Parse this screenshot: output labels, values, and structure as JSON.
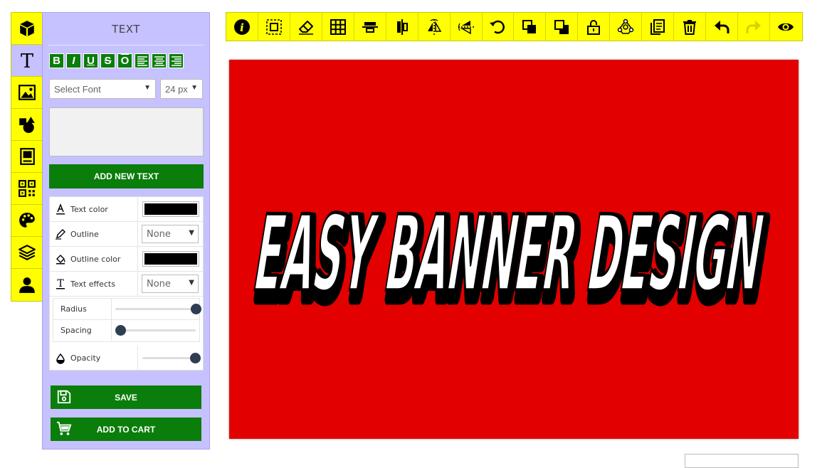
{
  "panel": {
    "title": "TEXT",
    "format_buttons": [
      "B",
      "I",
      "U",
      "S",
      "O"
    ],
    "font_select": "Select Font",
    "size_select": "24 px",
    "add_text_label": "ADD NEW TEXT",
    "properties": {
      "text_color_label": "Text color",
      "text_color_value": "#000000",
      "outline_label": "Outline",
      "outline_value": "None",
      "outline_color_label": "Outline color",
      "outline_color_value": "#000000",
      "text_effects_label": "Text effects",
      "text_effects_value": "None",
      "radius_label": "Radius",
      "radius_value": 1.0,
      "spacing_label": "Spacing",
      "spacing_value": 0.0,
      "opacity_label": "Opacity",
      "opacity_value": 1.0
    },
    "save_label": "SAVE",
    "cart_label": "ADD TO CART"
  },
  "canvas": {
    "background": "#e30000",
    "text": "EASY BANNER DESIGN",
    "text_fill": "#ffffff",
    "text_stroke": "#000000"
  },
  "colors": {
    "toolbar": "#ffff00",
    "panel": "#c6c1ff",
    "button_green": "#0a7d0a"
  },
  "sidebar_icons": [
    "product-icon",
    "text-icon",
    "image-icon",
    "shapes-icon",
    "clipart-icon",
    "qr-code-icon",
    "palette-icon",
    "layers-icon",
    "user-icon"
  ],
  "toolbar_icons": [
    "info-icon",
    "select-icon",
    "eraser-icon",
    "grid-icon",
    "align-center-vertical-icon",
    "align-center-horizontal-icon",
    "flip-horizontal-icon",
    "flip-vertical-icon",
    "rotate-icon",
    "bring-forward-icon",
    "send-backward-icon",
    "lock-icon",
    "group-icon",
    "duplicate-icon",
    "delete-icon",
    "undo-icon",
    "redo-icon",
    "preview-icon"
  ]
}
